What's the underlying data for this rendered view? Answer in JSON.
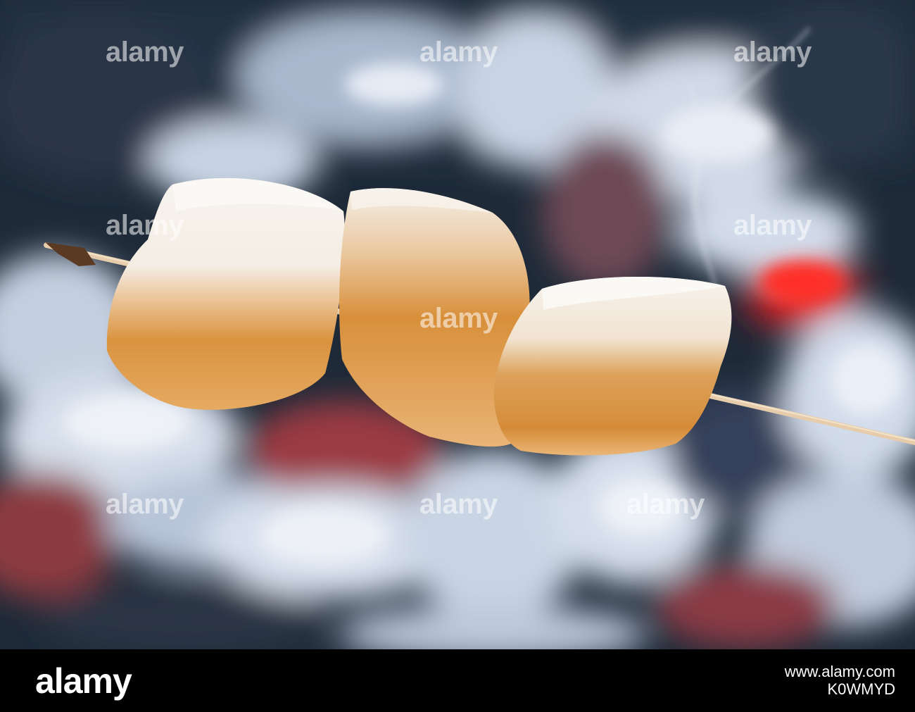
{
  "photo": {
    "subject": "marshmallows-on-skewer",
    "colors": {
      "ash": "#cfd8e6",
      "coal": "#1e2a38",
      "ember": "#e0272a",
      "marshmallow": "#f3eee6",
      "toasted": "#d9903c",
      "skewer": "#e6ccaa"
    }
  },
  "watermark": {
    "text": "alamy"
  },
  "footer": {
    "logo": "alamy",
    "image_id_line1": "www.alamy.com",
    "image_id_line2": "K0WMYD"
  }
}
